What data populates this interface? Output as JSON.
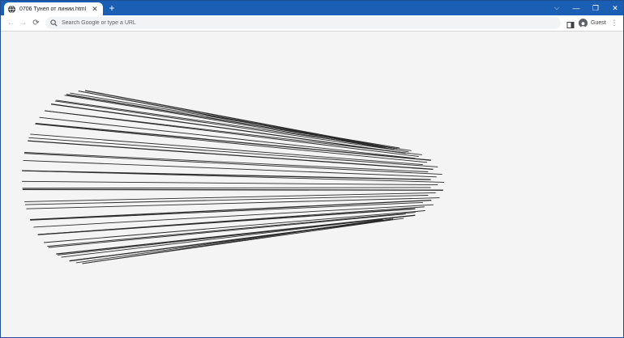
{
  "tab": {
    "title": "0706 Тунел от линии.html",
    "close_symbol": "✕",
    "favicon": "globe-icon"
  },
  "tabstrip": {
    "new_tab_symbol": "+",
    "accent_color": "#1a5fb4"
  },
  "window_controls": {
    "tab_search": "⌵",
    "minimize": "—",
    "restore": "❐",
    "close": "✕"
  },
  "toolbar": {
    "back_symbol": "←",
    "forward_symbol": "→",
    "reload_symbol": "⟳",
    "omnibox_placeholder": "Search Google or type a URL",
    "omnibox_value": "",
    "profile_label": "Guest",
    "menu_symbol": "⋮"
  },
  "page": {
    "background_color": "#f4f4f4",
    "line_color": "#2a2a2a"
  }
}
